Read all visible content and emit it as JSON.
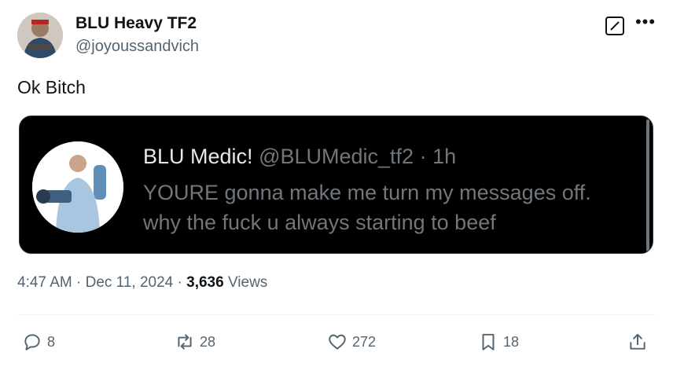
{
  "author": {
    "display_name": "BLU Heavy TF2",
    "handle": "@joyoussandvich"
  },
  "tweet": {
    "text": "Ok Bitch",
    "time": "4:47 AM",
    "date": "Dec 11, 2024",
    "views_count": "3,636",
    "views_label": "Views"
  },
  "quote": {
    "display_name": "BLU Medic!",
    "handle": "@BLUMedic_tf2",
    "age": "1h",
    "text": "YOURE gonna make me turn my messages off. why the fuck u always starting to beef"
  },
  "actions": {
    "replies": "8",
    "reposts": "28",
    "likes": "272",
    "bookmarks": "18"
  },
  "icons": [
    "grok-icon",
    "more-icon",
    "reply-icon",
    "repost-icon",
    "like-icon",
    "bookmark-icon",
    "share-icon"
  ],
  "colors": {
    "text_primary": "#0f1419",
    "text_secondary": "#536471",
    "quote_background": "#000000"
  }
}
